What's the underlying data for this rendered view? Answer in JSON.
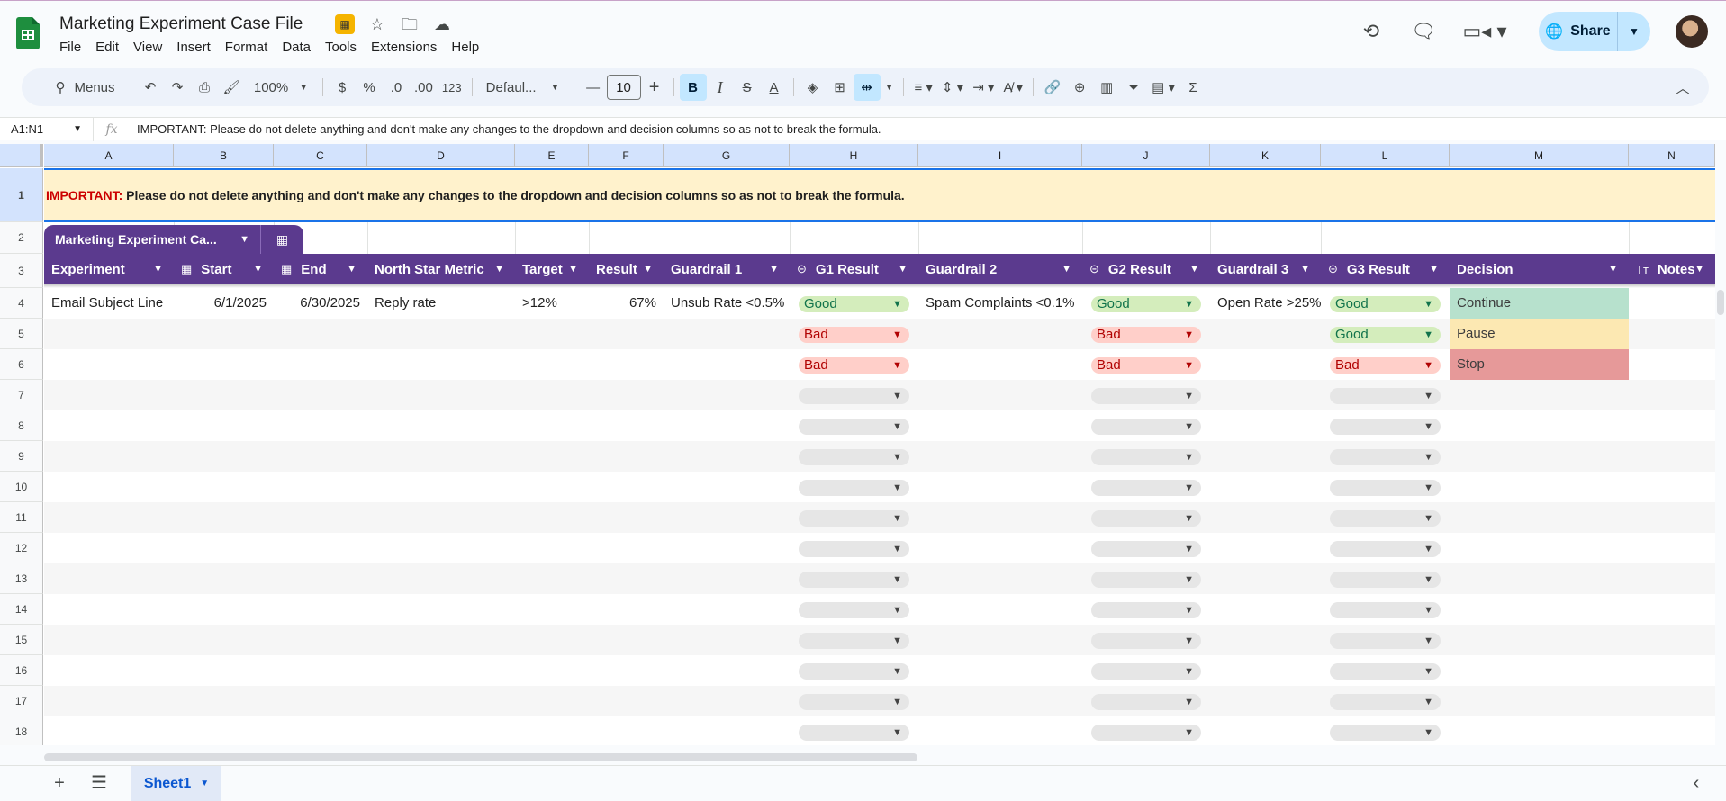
{
  "app": {
    "doc_title": "Marketing Experiment Case File",
    "menu": [
      "File",
      "Edit",
      "View",
      "Insert",
      "Format",
      "Data",
      "Tools",
      "Extensions",
      "Help"
    ],
    "share_label": "Share"
  },
  "toolbar": {
    "search_label": "Menus",
    "zoom": "100%",
    "currency": "$",
    "percent": "%",
    "dec_decrease": ".0",
    "dec_increase": ".00",
    "format_num": "123",
    "font": "Defaul...",
    "font_size": "10",
    "bold": "B",
    "italic": "I",
    "strike": "S",
    "text_color": "A",
    "sigma": "Σ"
  },
  "formula_bar": {
    "cell_ref": "A1:N1",
    "fx": "fx",
    "content": "IMPORTANT: Please do not delete anything and don't make any changes to the dropdown and decision columns so as not to break the formula."
  },
  "columns": [
    "A",
    "B",
    "C",
    "D",
    "E",
    "F",
    "G",
    "H",
    "I",
    "J",
    "K",
    "L",
    "M",
    "N"
  ],
  "rows": [
    "1",
    "2",
    "3",
    "4",
    "5",
    "6",
    "7",
    "8",
    "9",
    "10",
    "11",
    "12",
    "13",
    "14",
    "15",
    "16",
    "17",
    "18"
  ],
  "banner": {
    "important": "IMPORTANT:",
    "text": " Please do not delete anything and don't make any changes to the dropdown and decision columns so as not to break the formula."
  },
  "table": {
    "name": "Marketing Experiment Ca...",
    "headers": [
      "Experiment",
      "Start",
      "End",
      "North Star Metric",
      "Target",
      "Result",
      "Guardrail 1",
      "G1 Result",
      "Guardrail 2",
      "G2 Result",
      "Guardrail 3",
      "G3 Result",
      "Decision",
      "Notes"
    ],
    "row4": {
      "experiment": "Email Subject Line",
      "start": "6/1/2025",
      "end": "6/30/2025",
      "metric": "Reply rate",
      "target": ">12%",
      "result": "67%",
      "guardrail1": "Unsub Rate <0.5%",
      "g1": "Good",
      "guardrail2": "Spam Complaints <0.1%",
      "g2": "Good",
      "guardrail3": "Open Rate >25%",
      "g3": "Good",
      "decision": "Continue"
    },
    "row5": {
      "g1": "Bad",
      "g2": "Bad",
      "g3": "Good",
      "decision": "Pause"
    },
    "row6": {
      "g1": "Bad",
      "g2": "Bad",
      "g3": "Bad",
      "decision": "Stop"
    }
  },
  "colors": {
    "header_purple": "#5b3a8e",
    "banner_yellow": "#fff2cc",
    "continue": "#b7e1cd",
    "pause": "#fce8b2",
    "stop": "#e69999"
  },
  "sheet_tab": "Sheet1"
}
